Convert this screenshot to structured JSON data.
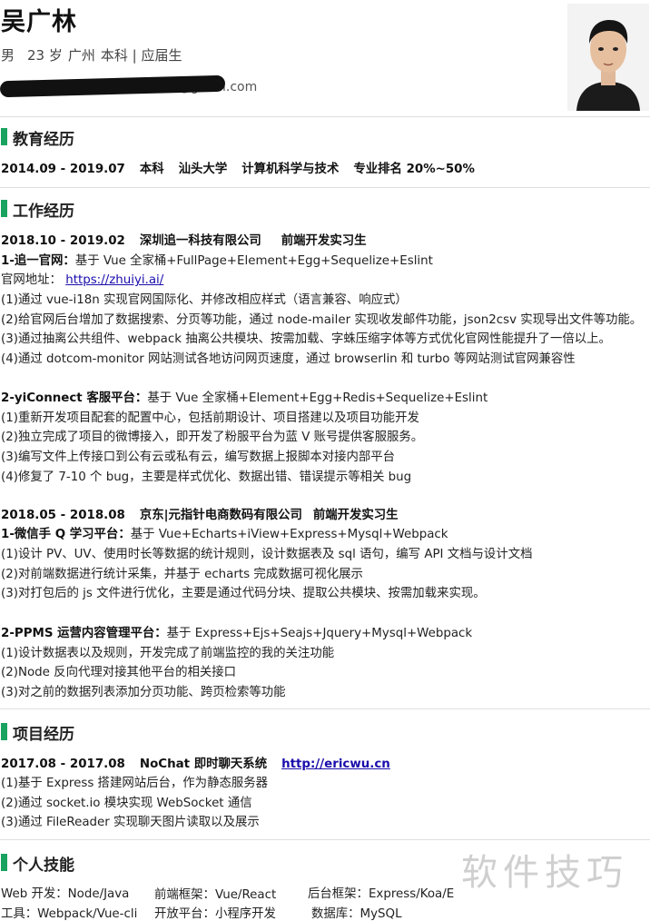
{
  "header": {
    "name": "吴广林",
    "gender": "男",
    "age": "23 岁",
    "city": "广州",
    "degree_status": "本科 | 应届生",
    "email": "@gmail.com"
  },
  "sections": {
    "education": "教育经历",
    "work": "工作经历",
    "projects": "项目经历",
    "skills": "个人技能"
  },
  "education": {
    "period": "2014.09 - 2019.07",
    "degree": "本科",
    "school": "汕头大学",
    "major": "计算机科学与技术",
    "rank": "专业排名 20%~50%"
  },
  "work": {
    "job1": {
      "period": "2018.10 - 2019.02",
      "company": "深圳追一科技有限公司",
      "role": "前端开发实习生",
      "p1_title": "1-追一官网：",
      "p1_stack": "基于 Vue 全家桶+FullPage+Element+Egg+Sequelize+Eslint",
      "p1_site_label": "官网地址：",
      "p1_site_url": "https://zhuiyi.ai/",
      "p1_items": [
        "(1)通过 vue-i18n 实现官网国际化、并修改相应样式（语言兼容、响应式）",
        "(2)给官网后台增加了数据搜索、分页等功能，通过 node-mailer 实现收发邮件功能，json2csv 实现导出文件等功能。",
        "(3)通过抽离公共组件、webpack 抽离公共模块、按需加载、字蛛压缩字体等方式优化官网性能提升了一倍以上。",
        "(4)通过 dotcom-monitor 网站测试各地访问网页速度，通过 browserlin 和 turbo 等网站测试官网兼容性"
      ],
      "p2_title": "2-yiConnect 客服平台：",
      "p2_stack": "基于 Vue 全家桶+Element+Egg+Redis+Sequelize+Eslint",
      "p2_items": [
        "(1)重新开发项目配套的配置中心，包括前期设计、项目搭建以及项目功能开发",
        "(2)独立完成了项目的微博接入，即开发了粉服平台为蓝 V 账号提供客服服务。",
        "(3)编写文件上传接口到公有云或私有云，编写数据上报脚本对接内部平台",
        "(4)修复了 7-10 个 bug，主要是样式优化、数据出错、错误提示等相关 bug"
      ]
    },
    "job2": {
      "period": "2018.05 - 2018.08",
      "company": "京东|元指针电商数码有限公司",
      "role": "前端开发实习生",
      "p1_title": "1-微信手 Q 学习平台：",
      "p1_stack": "基于 Vue+Echarts+iView+Express+Mysql+Webpack",
      "p1_items": [
        "(1)设计 PV、UV、使用时长等数据的统计规则，设计数据表及 sql 语句，编写 API 文档与设计文档",
        "(2)对前端数据进行统计采集，并基于 echarts 完成数据可视化展示",
        "(3)对打包后的 js 文件进行优化，主要是通过代码分块、提取公共模块、按需加载来实现。"
      ],
      "p2_title": "2-PPMS 运营内容管理平台：",
      "p2_stack": "基于 Express+Ejs+Seajs+Jquery+Mysql+Webpack",
      "p2_items": [
        "(1)设计数据表以及规则，开发完成了前端监控的我的关注功能",
        "(2)Node 反向代理对接其他平台的相关接口",
        "(3)对之前的数据列表添加分页功能、跨页检索等功能"
      ]
    }
  },
  "project": {
    "period": "2017.08 - 2017.08",
    "name": "NoChat 即时聊天系统",
    "url": "http://ericwu.cn",
    "items": [
      "(1)基于 Express 搭建网站后台，作为静态服务器",
      "(2)通过 socket.io 模块实现 WebSocket 通信",
      "(3)通过 FileReader 实现聊天图片读取以及展示"
    ]
  },
  "skills": {
    "row1": [
      "Web 开发：Node/Java",
      "前端框架：Vue/React",
      "后台框架：Express/Koa/E"
    ],
    "row2": [
      "工具：Webpack/Vue-cli",
      "开放平台：小程序开发",
      "数据库：MySQL"
    ]
  },
  "watermark": "软件技巧",
  "colors": {
    "accent": "#1aa260",
    "link": "#1a0dab"
  }
}
